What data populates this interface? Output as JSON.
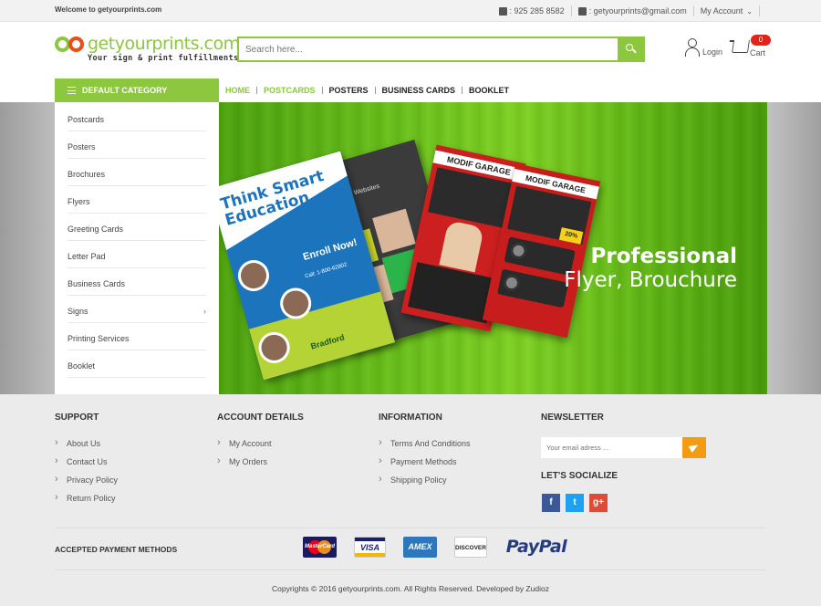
{
  "topbar": {
    "welcome": "Welcome to getyourprints.com",
    "phone": ": 925 285 8582",
    "email": ": getyourprints@gmail.com",
    "account": "My Account"
  },
  "header": {
    "logo_title": "getyourprints.com",
    "logo_tagline": "Your sign & print fulfillments",
    "search_placeholder": "Search here...",
    "login_label": "Login",
    "cart_label": "Cart",
    "cart_count": "0"
  },
  "nav": {
    "category_button": "DEFAULT CATEGORY",
    "menu": [
      {
        "label": "HOME"
      },
      {
        "label": "POSTCARDS"
      },
      {
        "label": "POSTERS"
      },
      {
        "label": "BUSINESS CARDS"
      },
      {
        "label": "BOOKLET"
      }
    ]
  },
  "categories": [
    {
      "label": "Postcards"
    },
    {
      "label": "Posters"
    },
    {
      "label": "Brochures"
    },
    {
      "label": "Flyers"
    },
    {
      "label": "Greeting Cards"
    },
    {
      "label": "Letter Pad"
    },
    {
      "label": "Business Cards"
    },
    {
      "label": "Signs",
      "arrow": "›"
    },
    {
      "label": "Printing Services"
    },
    {
      "label": "Booklet"
    }
  ],
  "banner": {
    "line1": "Professional",
    "line2": "Flyer, Brouchure",
    "flyer_edu_title": "Think Smart Education",
    "flyer_edu_enroll": "Enroll Now!",
    "flyer_edu_call": "Call: 1-800-62802",
    "flyer_edu_school": "Bradford",
    "flyer_garage_1": "MODIF GARAGE",
    "flyer_garage_2": "MODIF GARAGE",
    "flyer_discount": "20%"
  },
  "footer": {
    "support": {
      "title": "SUPPORT",
      "links": [
        "About Us",
        "Contact Us",
        "Privacy Policy",
        "Return Policy"
      ]
    },
    "account": {
      "title": "ACCOUNT DETAILS",
      "links": [
        "My Account",
        "My Orders"
      ]
    },
    "information": {
      "title": "INFORMATION",
      "links": [
        "Terms And Conditions",
        "Payment Methods",
        "Shipping Policy"
      ]
    },
    "newsletter": {
      "title": "NEWSLETTER",
      "placeholder": "Your email adress ...",
      "social_title": "LET'S SOCIALIZE",
      "social": [
        "f",
        "t",
        "g+"
      ]
    },
    "payment_title": "ACCEPTED PAYMENT METHODS",
    "cards": [
      "MasterCard",
      "VISA",
      "AMEX",
      "DISCOVER",
      "PayPal"
    ],
    "copyright": "Copyrights © 2016 getyourprints.com. All Rights Reserved. Developed by Zudioz"
  },
  "colors": {
    "brand_green": "#8dc63f",
    "brand_orange": "#e94e1b",
    "cart_badge": "#e2231a",
    "newsletter_button": "#f39c12"
  }
}
